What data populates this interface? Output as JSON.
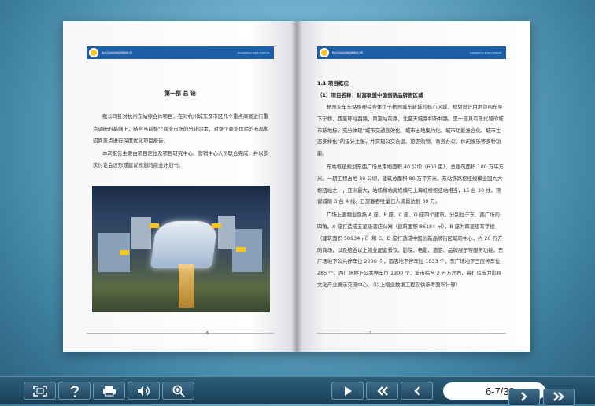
{
  "left_page": {
    "banner_text": "杭州东站综合体招商策划公司",
    "banner_right": "HANGZHOU EAST STATION",
    "chapter_title": "第一部  总  论",
    "paragraphs": [
      "我公司针对杭州东站综合体项目，在对杭州城东及市区几个重点商圈进行重点调研的基础上，结合当前整个商业市场的分化因素，对整个商业体验的布局和招商重点进行深度优化项目报告。",
      "本次报告主要由项目定位及项目研究中心、营销中心人员联合完成，并以多次讨论会议形成建议规划的商业计划书。"
    ],
    "page_number": "6"
  },
  "right_page": {
    "banner_text": "杭州东站综合体招商策划公司",
    "banner_right": "HANGZHOU EAST STATION",
    "section_title": "1.1 项目概况",
    "project_label": "（1）项目名称：",
    "project_name": "财富联盟中国创新品牌街区城",
    "paragraphs": [
      "杭州火车东站枢纽综合体位于杭州城东新城的核心区域，规划设计用地范围东至下宁桥，西至环站西路，南至站前路，北至天城路和新利路。是一座具有现代感的城市新地标，充分体现“城市交通高效化、城市土地集约化、城市功能复合化、城市生态多样化”的设计主张，并实现公交合运、旅游购物、商务办公、休闲娱乐等多种功能。",
      "东站枢纽规划东西广场总用地面积 40 公顷（600 亩），总建筑面积 100 万平方米。一期工程占地 30 公顷，建筑总面积 80 万平方米。东站铁路枢纽规模全国九大枢纽站之一，亚洲最大，站场和站房规模与上海虹桥枢纽站相当，15 台 30 线，预留城际 3 台 4 线。日旅客吞吐量日人流量达到 30 万。",
      "广场上盖物业包括 A 座、B 座、C 座、D 座四个建筑，分别位于东、西广场的四角。A 座打造成五星级酒店公寓（建筑面积 86184 ㎡），B 座为四星级写字楼（建筑面积 50934 ㎡）和 C、D 座打造成中国创新品牌街区城的中心，约 20 万方的商场，以及结合以上物业配套餐饮、影院、电影、旅游、品牌展示等服务功能。东广场地下公共停车位 2000 个，酒店地下停车位 1033 个，东广场地下三层停车位 285 个，西广场地下公共停车位 1900 个，城市综合 2 万方左右，将打造成为影视文化产业展示交流中心。（以上物业数据工程仅供参考面积计算）"
    ],
    "page_number": "7"
  },
  "toolbar": {
    "page_indicator": "6-7/30"
  },
  "icons": {
    "fullscreen": "fullscreen-icon",
    "help": "help-icon",
    "print": "print-icon",
    "sound": "speaker-icon",
    "zoom": "zoom-in-icon",
    "play": "play-icon",
    "first": "first-page-icon",
    "prev": "prev-page-icon",
    "next": "next-page-icon",
    "last": "last-page-icon"
  },
  "colors": {
    "banner": "#1f5fa8",
    "toolbar": "#1a3e57",
    "logo": "#f3c623"
  }
}
